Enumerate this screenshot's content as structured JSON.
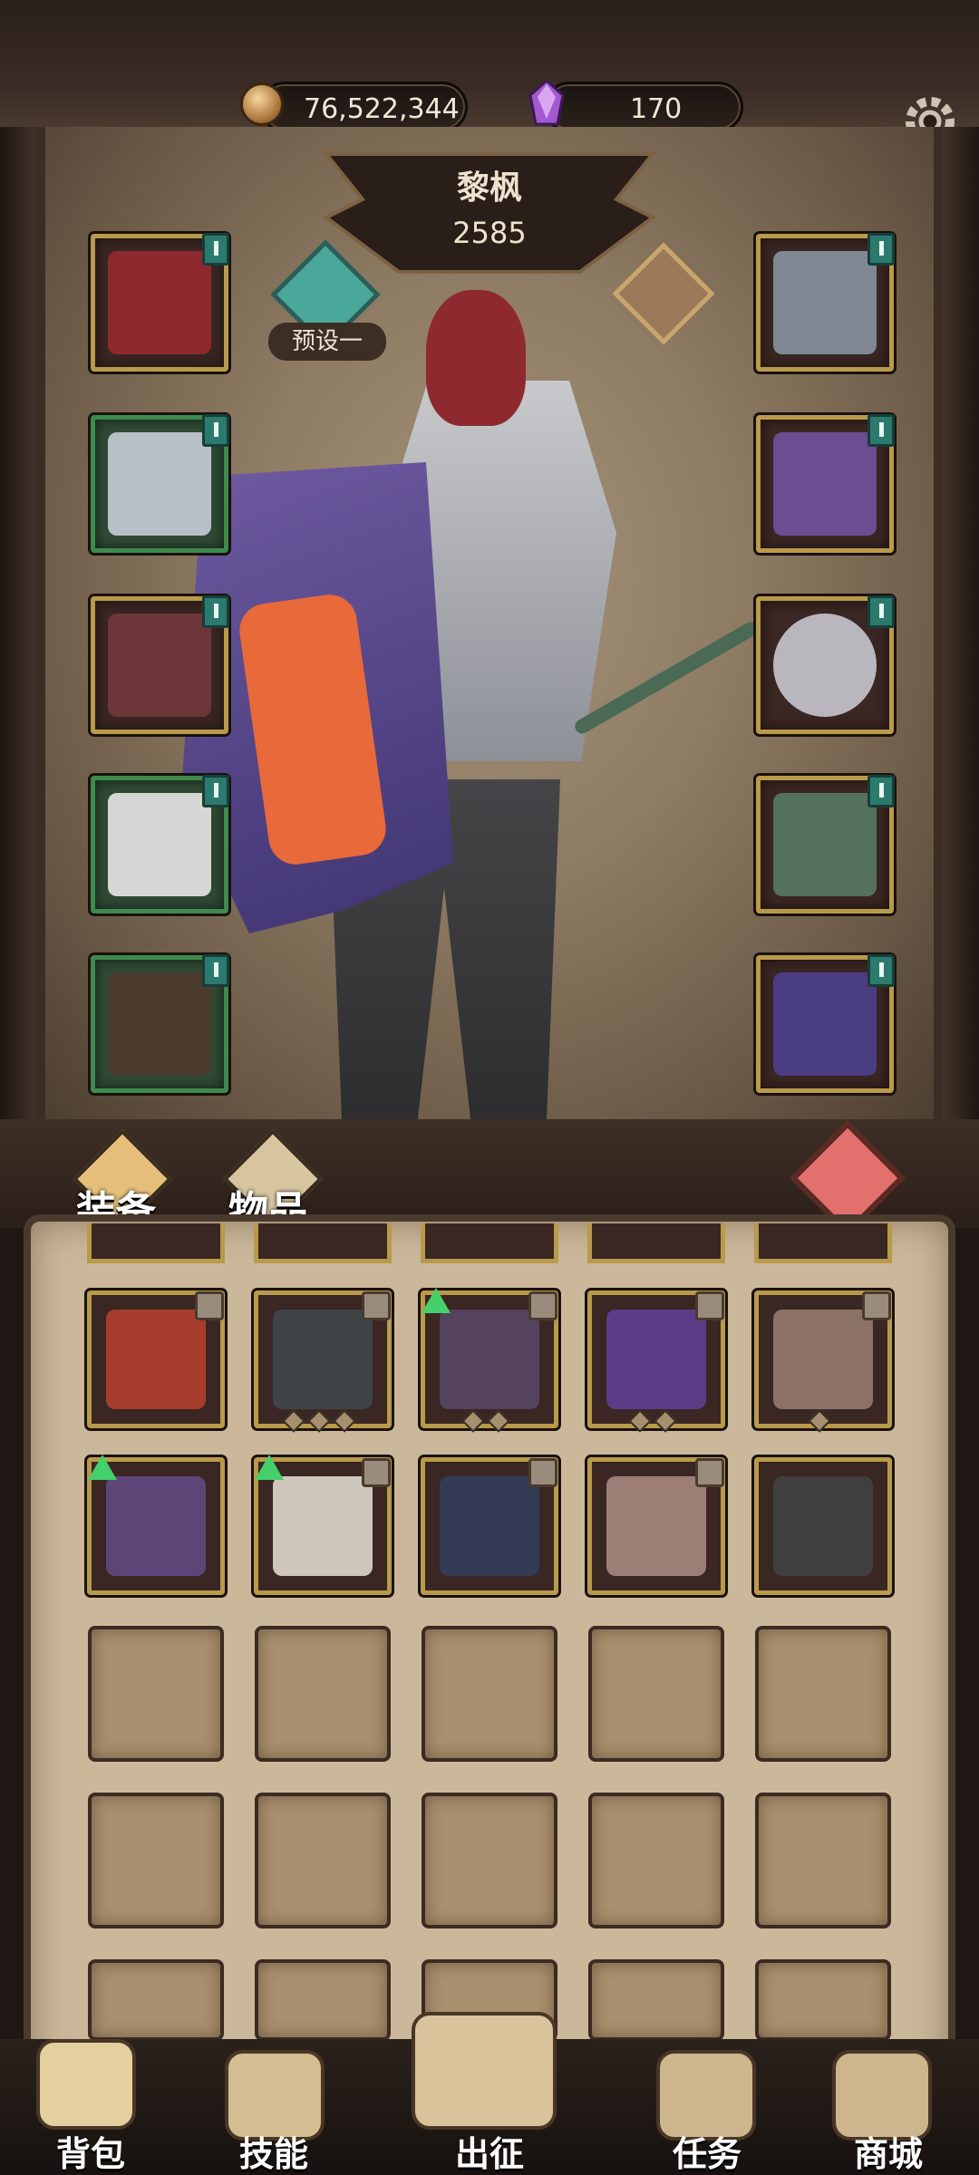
{
  "currencies": {
    "gold": "76,522,344",
    "gems": "170"
  },
  "hero": {
    "name": "黎枫",
    "power": "2585",
    "preset_label": "预设一"
  },
  "equipment": {
    "left": [
      {
        "name": "helmet",
        "frame": "gold",
        "art_color": "#8e2a2f"
      },
      {
        "name": "armor",
        "frame": "green",
        "art_color": "#b9bfc6"
      },
      {
        "name": "gauntlets",
        "frame": "gold",
        "art_color": "#6d3638"
      },
      {
        "name": "pants",
        "frame": "green",
        "art_color": "#d6d6d4"
      },
      {
        "name": "boots",
        "frame": "green",
        "art_color": "#4b3b2e"
      }
    ],
    "right": [
      {
        "name": "necklace",
        "frame": "gold",
        "art_color": "#7f8894"
      },
      {
        "name": "shoulder",
        "frame": "gold",
        "art_color": "#6b4d92"
      },
      {
        "name": "ring",
        "frame": "gold",
        "art_color": "#b9b6bd"
      },
      {
        "name": "weapon",
        "frame": "gold",
        "art_color": "#54705f"
      },
      {
        "name": "shield",
        "frame": "gold",
        "art_color": "#4a3d82"
      }
    ]
  },
  "tabs": {
    "equipment": "装备",
    "items": "物品"
  },
  "inventory": {
    "row1": [
      {
        "name": "chest-armor",
        "art_color": "#a63d2c",
        "lock": true,
        "upgrade": false,
        "stars": 0
      },
      {
        "name": "leg-armor",
        "art_color": "#3f4446",
        "lock": true,
        "upgrade": false,
        "stars": 3
      },
      {
        "name": "scythe",
        "art_color": "#54425e",
        "lock": true,
        "upgrade": true,
        "stars": 2
      },
      {
        "name": "dagger",
        "art_color": "#5a3d86",
        "lock": true,
        "upgrade": false,
        "stars": 2
      },
      {
        "name": "blade",
        "art_color": "#8c7266",
        "lock": true,
        "upgrade": false,
        "stars": 1
      }
    ],
    "row2": [
      {
        "name": "skull-shoulder",
        "art_color": "#5c4678",
        "lock": false,
        "upgrade": true,
        "stars": 0
      },
      {
        "name": "bone-staff",
        "art_color": "#cfc7bb",
        "lock": true,
        "upgrade": true,
        "stars": 0
      },
      {
        "name": "dark-helm",
        "art_color": "#333b55",
        "lock": true,
        "upgrade": false,
        "stars": 0
      },
      {
        "name": "curved-blade",
        "art_color": "#9c7e76",
        "lock": true,
        "upgrade": false,
        "stars": 0
      },
      {
        "name": "feather-hat",
        "art_color": "#3f3f3f",
        "lock": false,
        "upgrade": false,
        "stars": 0
      }
    ]
  },
  "nav": [
    {
      "key": "bag",
      "label": "背包",
      "icon": "backpack-icon"
    },
    {
      "key": "skills",
      "label": "技能",
      "icon": "scroll-icon"
    },
    {
      "key": "expedition",
      "label": "出征",
      "icon": "map-sword-icon"
    },
    {
      "key": "tasks",
      "label": "任务",
      "icon": "horn-icon"
    },
    {
      "key": "shop",
      "label": "商城",
      "icon": "crown-icon"
    }
  ],
  "colors": {
    "accent_teal": "#49a89a",
    "gold_frame": "#b89a4a",
    "green_frame": "#3f8a4e",
    "trash_red": "#e2706c"
  }
}
